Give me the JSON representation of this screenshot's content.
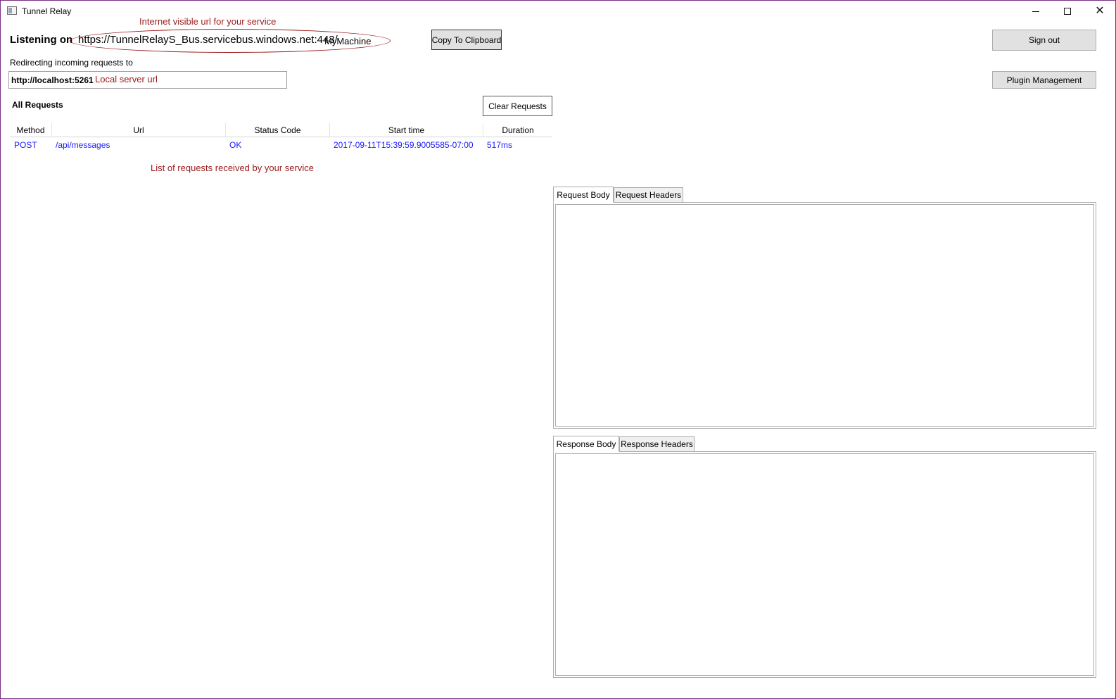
{
  "window": {
    "title": "Tunnel Relay"
  },
  "annotations": {
    "internet_url": "Internet visible url for your service",
    "local_url": "Local server url",
    "requests_list": "List of requests received by your service"
  },
  "listening": {
    "label": "Listening on",
    "url": "https://TunnelRelayS_Bus.servicebus.windows.net:443/",
    "suffix": "MyMachine",
    "copy_label": "Copy To Clipboard"
  },
  "redirect": {
    "label": "Redirecting incoming requests to",
    "value": "http://localhost:5261"
  },
  "header_buttons": {
    "sign_out": "Sign out",
    "plugin_management": "Plugin Management"
  },
  "requests": {
    "title": "All Requests",
    "clear_label": "Clear Requests",
    "columns": [
      "Method",
      "Url",
      "Status Code",
      "Start time",
      "Duration"
    ],
    "rows": [
      {
        "method": "POST",
        "url": "/api/messages",
        "status": "OK",
        "start_time": "2017-09-11T15:39:59.9005585-07:00",
        "duration": "517ms"
      }
    ]
  },
  "request_tabs": [
    "Request Body",
    "Request Headers"
  ],
  "response_tabs": [
    "Response Body",
    "Response Headers"
  ],
  "colors": {
    "annotation": "#9b1b1b",
    "row_text": "#1a1aff",
    "window_border": "#7a2b86"
  }
}
